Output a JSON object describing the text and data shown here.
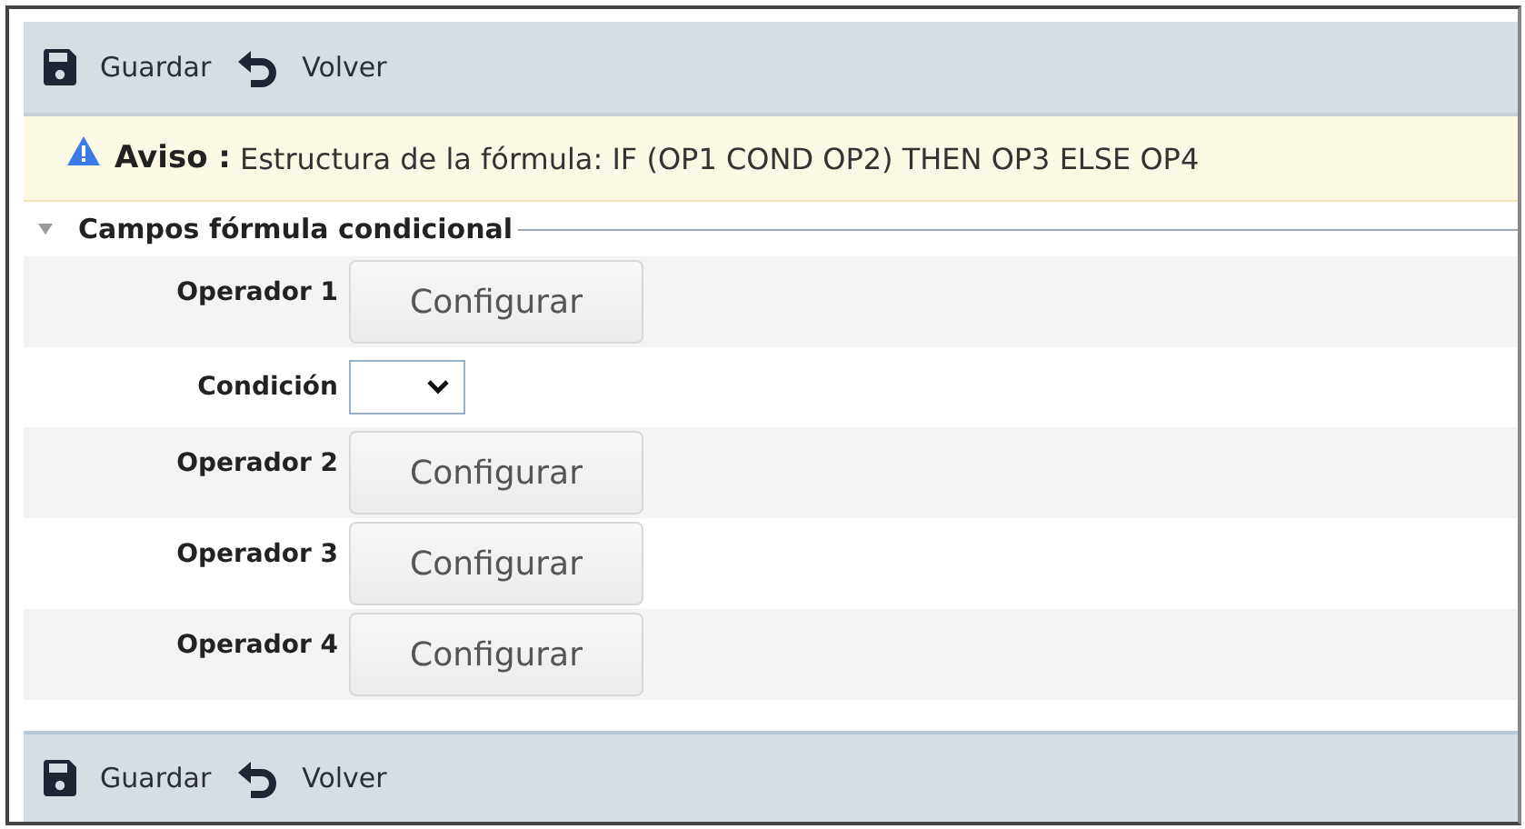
{
  "toolbar_top": [
    {
      "kind": "save",
      "label": "Guardar"
    },
    {
      "kind": "back",
      "label": "Volver"
    }
  ],
  "notice": {
    "label": "Aviso :",
    "text": "Estructura de la fórmula: IF (OP1 COND OP2) THEN OP3 ELSE OP4"
  },
  "section": {
    "title": "Campos fórmula condicional",
    "expanded": true
  },
  "fields": [
    {
      "kind": "button",
      "label": "Operador 1",
      "button": "Configurar"
    },
    {
      "kind": "select",
      "label": "Condición"
    },
    {
      "kind": "button",
      "label": "Operador 2",
      "button": "Configurar"
    },
    {
      "kind": "button",
      "label": "Operador 3",
      "button": "Configurar"
    },
    {
      "kind": "button",
      "label": "Operador 4",
      "button": "Configurar"
    }
  ],
  "toolbar_bottom": [
    {
      "kind": "save",
      "label": "Guardar"
    },
    {
      "kind": "back",
      "label": "Volver"
    }
  ]
}
